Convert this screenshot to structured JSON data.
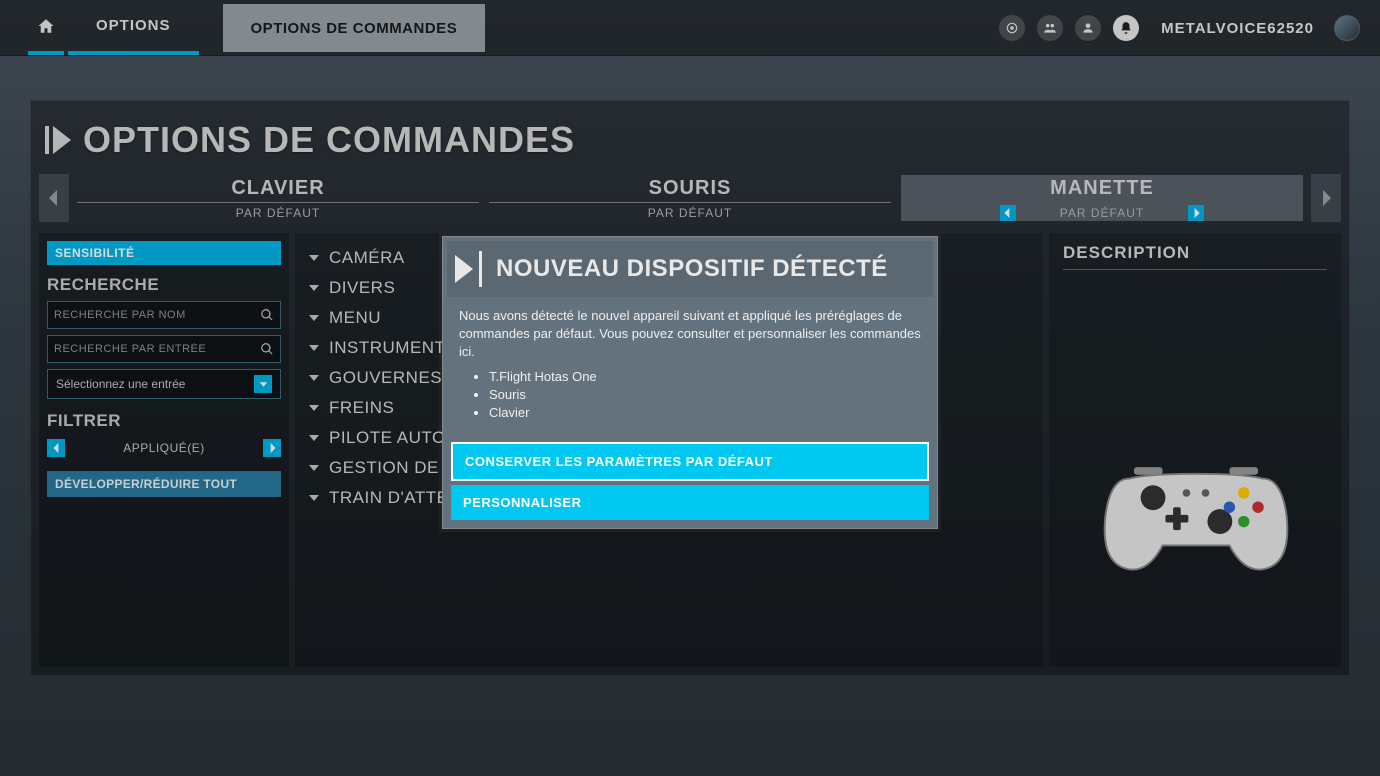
{
  "topbar": {
    "crumb1": "OPTIONS",
    "crumb2": "OPTIONS DE COMMANDES",
    "username": "METALVOICE62520"
  },
  "page_title": "OPTIONS DE COMMANDES",
  "devices": {
    "tabs": [
      {
        "name": "CLAVIER",
        "subtitle": "PAR DÉFAUT"
      },
      {
        "name": "SOURIS",
        "subtitle": "PAR DÉFAUT"
      },
      {
        "name": "MANETTE",
        "subtitle": "PAR DÉFAUT"
      }
    ],
    "active_index": 2
  },
  "sidebar": {
    "sensitivity_label": "SENSIBILITÉ",
    "search_label": "RECHERCHE",
    "search_name_placeholder": "RECHERCHE PAR NOM",
    "search_input_placeholder": "RECHERCHE PAR ENTRÉE",
    "select_placeholder": "Sélectionnez une entrée",
    "filter_label": "FILTRER",
    "filter_value": "APPLIQUÉ(E)",
    "expand_label": "DÉVELOPPER/RÉDUIRE TOUT"
  },
  "categories": [
    "CAMÉRA",
    "DIVERS",
    "MENU",
    "INSTRUMENTS ET SYSTÈMES",
    "GOUVERNES DE VOL PRINCIPALES",
    "FREINS",
    "PILOTE AUTOMATIQUE",
    "GESTION DE PUISSANCE",
    "TRAIN D'ATTERRISSAGE"
  ],
  "description_label": "DESCRIPTION",
  "modal": {
    "title": "NOUVEAU DISPOSITIF DÉTECTÉ",
    "body_text": "Nous avons détecté le nouvel appareil suivant et appliqué les préréglages de commandes par défaut. Vous pouvez consulter et personnaliser les commandes ici.",
    "devices": [
      "T.Flight Hotas One",
      "Souris",
      "Clavier"
    ],
    "btn_keep": "CONSERVER LES PARAMÈTRES PAR DÉFAUT",
    "btn_custom": "PERSONNALISER"
  }
}
